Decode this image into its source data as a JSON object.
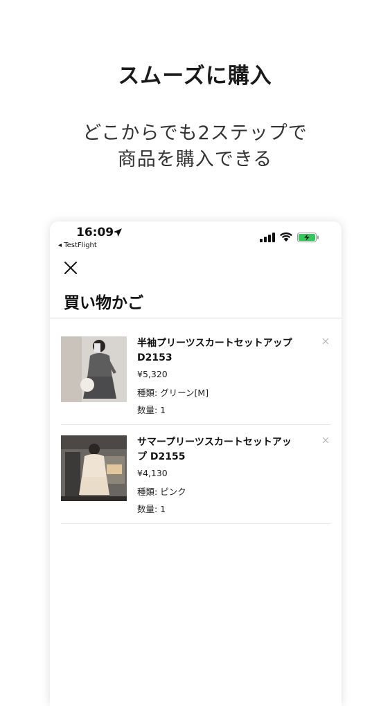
{
  "promo": {
    "headline": "スムーズに購入",
    "subtitle_line1": "どこからでも2ステップで",
    "subtitle_line2": "商品を購入できる"
  },
  "status_bar": {
    "time": "16:09",
    "back_app": "◂ TestFlight",
    "icons": [
      "location-arrow-icon",
      "signal-icon",
      "wifi-icon",
      "battery-charging-icon"
    ],
    "battery_color": "#34c759"
  },
  "cart": {
    "title": "買い物かご",
    "items": [
      {
        "name": "半袖プリーツスカートセットアップ D2153",
        "price": "¥5,320",
        "variant": "種類: グリーン[M]",
        "quantity": "数量: 1"
      },
      {
        "name": "サマープリーツスカートセットアップ D2155",
        "price": "¥4,130",
        "variant": "種類: ピンク",
        "quantity": "数量: 1"
      }
    ]
  }
}
